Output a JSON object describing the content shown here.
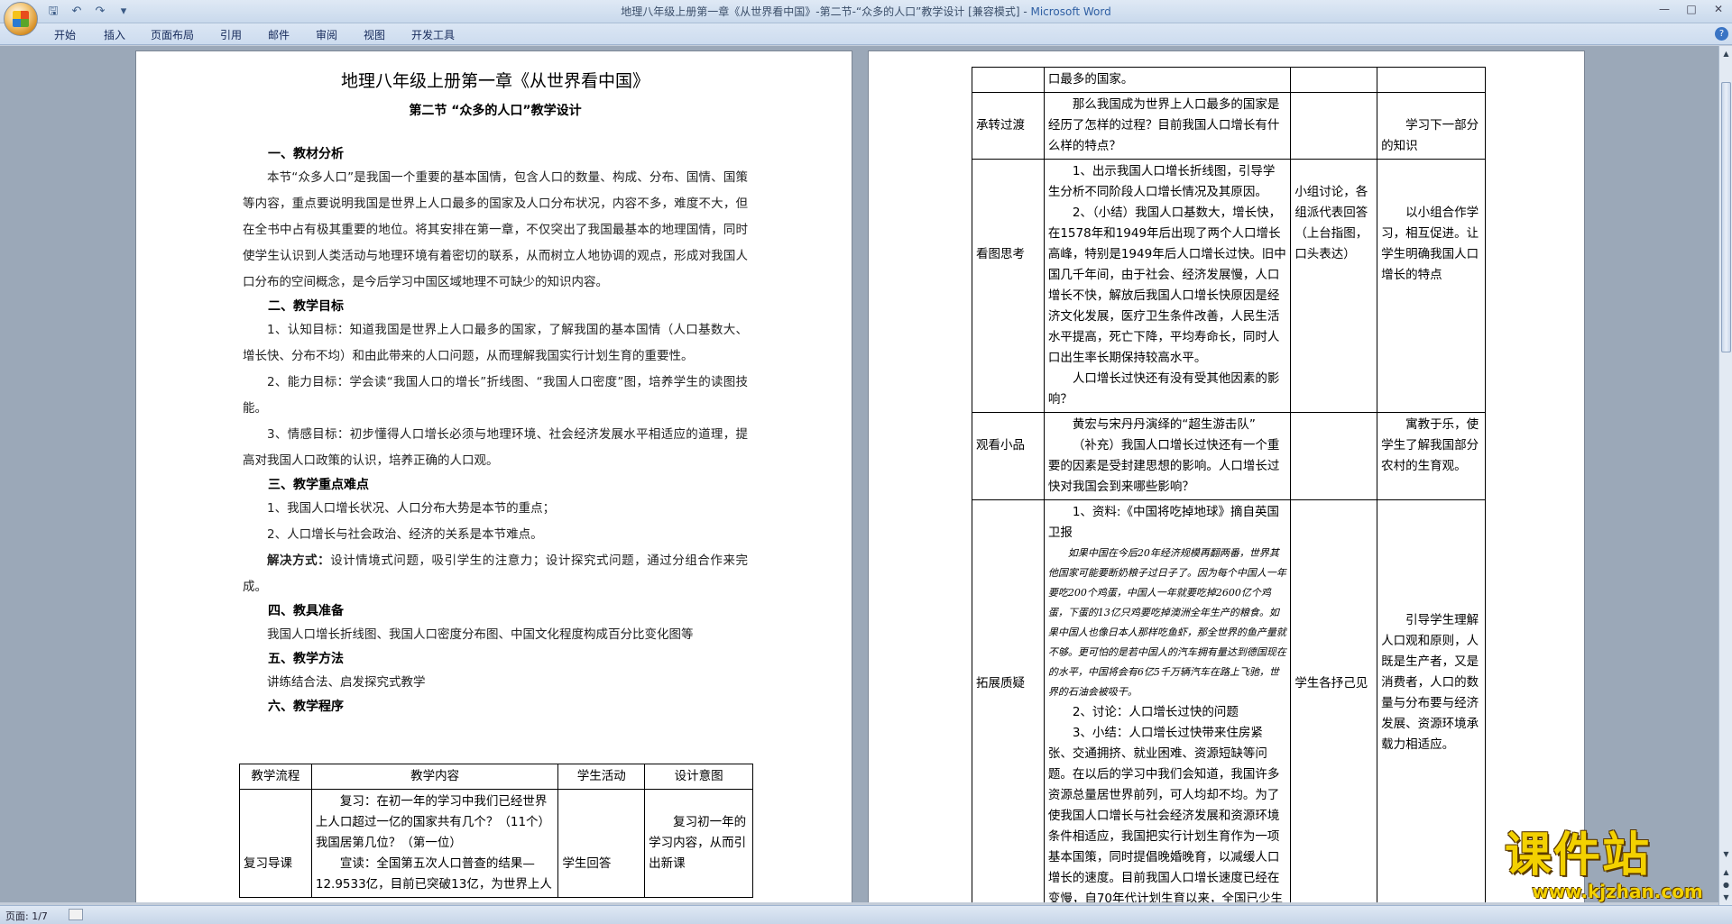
{
  "window": {
    "title": "地理八年级上册第一章《从世界看中国》-第二节-“众多的人口”教学设计 [兼容模式] - ",
    "app_name": "Microsoft Word"
  },
  "ribbon_tabs": [
    "开始",
    "插入",
    "页面布局",
    "引用",
    "邮件",
    "审阅",
    "视图",
    "开发工具"
  ],
  "status": {
    "page": "页面: 1/7"
  },
  "watermark": {
    "text": "课件站",
    "url": "www.kjzhan.com"
  },
  "page1": {
    "title": "地理八年级上册第一章《从世界看中国》",
    "subtitle": "第二节 “众多的人口”教学设计",
    "h1": "一、教材分析",
    "p1": "本节“众多人口”是我国一个重要的基本国情，包含人口的数量、构成、分布、国情、国策等内容，重点要说明我国是世界上人口最多的国家及人口分布状况，内容不多，难度不大，但在全书中占有极其重要的地位。将其安排在第一章，不仅突出了我国最基本的地理国情，同时使学生认识到人类活动与地理环境有着密切的联系，从而树立人地协调的观点，形成对我国人口分布的空间概念，是今后学习中国区域地理不可缺少的知识内容。",
    "h2": "二、教学目标",
    "goal1": "1、认知目标：知道我国是世界上人口最多的国家，了解我国的基本国情（人口基数大、增长快、分布不均）和由此带来的人口问题，从而理解我国实行计划生育的重要性。",
    "goal2": "2、能力目标：学会读“我国人口的增长”折线图、“我国人口密度”图，培养学生的读图技能。",
    "goal3": "3、情感目标：初步懂得人口增长必须与地理环境、社会经济发展水平相适应的道理，提高对我国人口政策的认识，培养正确的人口观。",
    "h3": "三、教学重点难点",
    "key1": "1、我国人口增长状况、人口分布大势是本节的重点；",
    "key2": "2、人口增长与社会政治、经济的关系是本节难点。",
    "solve_label": "解决方式：",
    "solve_text": "设计情境式问题，吸引学生的注意力；设计探究式问题，通过分组合作来完成。",
    "h4": "四、教具准备",
    "tools": "我国人口增长折线图、我国人口密度分布图、中国文化程度构成百分比变化图等",
    "h5": "五、教学方法",
    "method": "讲练结合法、启发探究式教学",
    "h6": "六、教学程序",
    "table": {
      "headers": [
        "教学流程",
        "教学内容",
        "学生活动",
        "设计意图"
      ],
      "row1": {
        "flow": "复习导课",
        "content1": "复习：在初一年的学习中我们已经世界上人口超过一亿的国家共有几个？（11个）我国居第几位？（第一位）",
        "content2": "宣读：全国第五次人口普查的结果—12.9533亿，目前已突破13亿，为世界上人",
        "activity": "学生回答",
        "intent": "复习初一年的学习内容，从而引出新课"
      }
    }
  },
  "page2": {
    "rows": [
      {
        "flow": "",
        "content": [
          "口最多的国家。"
        ],
        "activity": "",
        "intent": ""
      },
      {
        "flow": "承转过渡",
        "content": [
          "那么我国成为世界上人口最多的国家是经历了怎样的过程？目前我国人口增长有什么样的特点？"
        ],
        "activity": "",
        "intent": "学习下一部分的知识"
      },
      {
        "flow": "看图思考",
        "content": [
          "1、出示我国人口增长折线图，引导学生分析不同阶段人口增长情况及其原因。",
          "2、（小结）我国人口基数大，增长快，在1578年和1949年后出现了两个人口增长高峰，特别是1949年后人口增长过快。旧中国几千年间，由于社会、经济发展慢，人口增长不快，解放后我国人口增长快原因是经济文化发展，医疗卫生条件改善，人民生活水平提高，死亡下降，平均寿命长，同时人口出生率长期保持较高水平。",
          "人口增长过快还有没有受其他因素的影响？"
        ],
        "activity": "小组讨论，各组派代表回答（上台指图，口头表达）",
        "intent": "以小组合作学习，相互促进。让学生明确我国人口增长的特点"
      },
      {
        "flow": "观看小品",
        "content": [
          "黄宏与宋丹丹演绎的“超生游击队”",
          "（补充）我国人口增长过快还有一个重要的因素是受封建思想的影响。人口增长过快对我国会到来哪些影响？"
        ],
        "activity": "",
        "intent": "寓教于乐，使学生了解我国部分农村的生育观。"
      },
      {
        "flow": "拓展质疑",
        "content": [
          "1、资料:《中国将吃掉地球》摘自英国卫报",
          "如果中国在今后20年经济规模再翻两番，世界其他国家可能要断奶粮子过日子了。因为每个中国人一年要吃200个鸡蛋，中国人一年就要吃掉2600亿个鸡蛋，下蛋的13亿只鸡要吃掉澳洲全年生产的粮食。如果中国人也像日本人那样吃鱼虾，那全世界的鱼产量就不够。更可怕的是若中国人的汽车拥有量达到德国现在的水平，中国将会有6亿5千万辆汽车在路上飞驰，世界的石油会被吸干。",
          "2、讨论：人口增长过快的问题",
          "3、小结：人口增长过快带来住房紧张、交通拥挤、就业困难、资源短缺等问题。在以后的学习中我们会知道，我国许多资源总量居世界前列，可人均却不均。为了使我国人口增长与社会经济发展和资源环境条件相适应，我国把实行计划生育作为一项基本国策，同时提倡晚婚晚育，以减缓人口增长的速度。目前我国人口增长速度已经在变慢，自70年代计划生育以来，全国已少生"
        ],
        "activity": "学生各抒己见",
        "intent": "引导学生理解人口观和原则，人既是生产者，又是消费者，人口的数量与分布要与经济发展、资源环境承载力相适应。"
      }
    ]
  },
  "colors": {
    "accent": "#2f5fa3",
    "doc_bg": "#9ba8b8",
    "ribbon": "#dbe6f4"
  }
}
